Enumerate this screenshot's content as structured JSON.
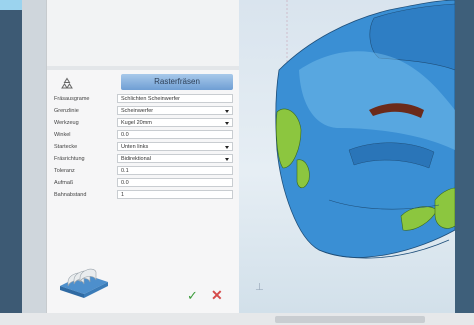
{
  "panel": {
    "title": "Rasterfräsen",
    "fields": [
      {
        "label": "Fräsausgrame",
        "value": "Schlichten Scheinwerfer",
        "dropdown": false
      },
      {
        "label": "Grenzlinie",
        "value": "Scheinwerfer",
        "dropdown": true
      },
      {
        "label": "Werkzeug",
        "value": "Kugel 20mm",
        "dropdown": true
      },
      {
        "label": "Winkel",
        "value": "0.0",
        "dropdown": false
      },
      {
        "label": "Startecke",
        "value": "Unten links",
        "dropdown": true
      },
      {
        "label": "Fräsrichtung",
        "value": "Bidirektional",
        "dropdown": true
      },
      {
        "label": "Toleranz",
        "value": "0.1",
        "dropdown": false
      },
      {
        "label": "Aufmaß",
        "value": "0.0",
        "dropdown": false
      },
      {
        "label": "Bahnabstand",
        "value": "1",
        "dropdown": false
      }
    ],
    "actions": {
      "ok": "✓",
      "cancel": "✕"
    },
    "icons": {
      "header": "recycle-icon",
      "tool": "raster-milling-tool-icon"
    }
  },
  "viewport": {
    "subject": "car-front-3d-model",
    "colors": {
      "body": "#3a8fd4",
      "highlight": "#7fc6ef",
      "headlights": "#8cc63f",
      "edges": "#1f4f7a"
    }
  }
}
